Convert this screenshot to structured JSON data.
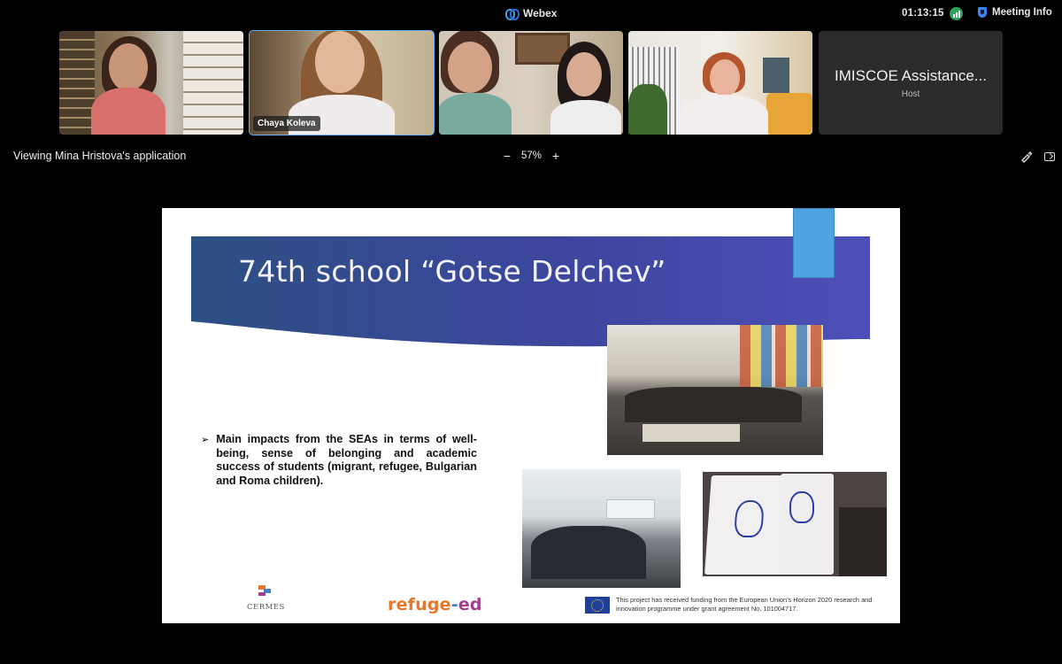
{
  "app": {
    "name": "Webex",
    "clock": "01:13:15",
    "meeting_info_label": "Meeting Info"
  },
  "participants": [
    {
      "name": "",
      "active": false
    },
    {
      "name": "Chaya Koleva",
      "active": true
    },
    {
      "name": "",
      "active": false
    },
    {
      "name": "",
      "active": false
    }
  ],
  "host": {
    "name": "IMISCOE Assistance...",
    "role": "Host"
  },
  "share": {
    "viewing_text": "Viewing Mina Hristova's application",
    "zoom_minus": "−",
    "zoom_level": "57%",
    "zoom_plus": "+"
  },
  "slide": {
    "title": "74th school “Gotse Delchev”",
    "bullet_marker": "➢",
    "bullet_text": "Main impacts from the SEAs in terms of well-being, sense of belonging and academic success of students (migrant, refugee, Bulgarian and Roma children).",
    "logo_cermes": "CERMES",
    "logo_refuge": {
      "part1": "refuge",
      "part2": "-",
      "part3": "ed"
    },
    "eu_funding": "This project has received funding from the European Union's Horizon 2020 research and innovation programme under grant agreement No. 101004717."
  },
  "colors": {
    "accent_blue": "#5fb3ff",
    "banner_dark": "#2c3e84",
    "banner_light": "#4a4fb3",
    "signal_green": "#2fa35b"
  },
  "icons": [
    "webex-logo",
    "signal-icon",
    "shield-icon",
    "annotate-icon",
    "share-icon"
  ]
}
